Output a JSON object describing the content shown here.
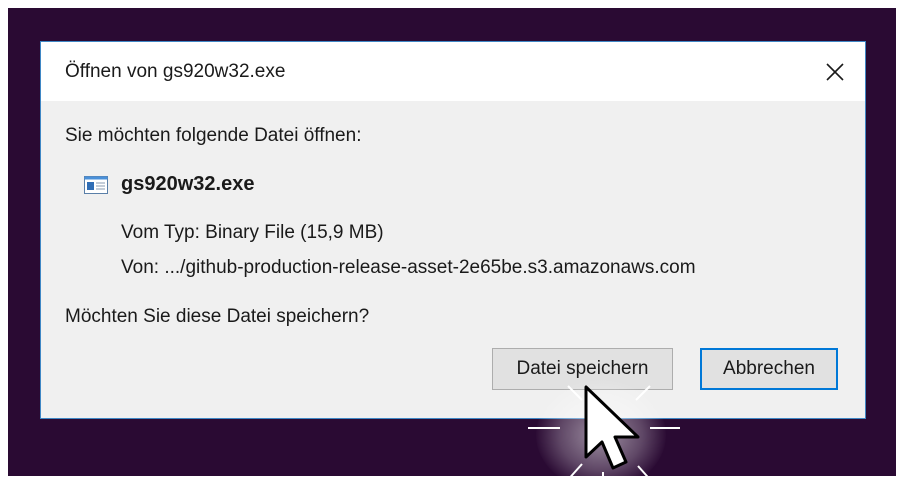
{
  "dialog": {
    "title": "Öffnen von gs920w32.exe",
    "prompt": "Sie möchten folgende Datei öffnen:",
    "file": {
      "icon": "executable-file-icon",
      "name": "gs920w32.exe",
      "type_label": "Vom Typ:",
      "type_value": "Binary File (15,9 MB)",
      "from_label": "Von:",
      "from_value": ".../github-production-release-asset-2e65be.s3.amazonaws.com"
    },
    "question": "Möchten Sie diese Datei speichern?",
    "buttons": {
      "save": "Datei speichern",
      "cancel": "Abbrechen"
    },
    "close_icon": "close-icon"
  },
  "colors": {
    "desktop_background": "#2a0a33",
    "dialog_border": "#3f87c5",
    "focused_button_border": "#0078d7"
  }
}
